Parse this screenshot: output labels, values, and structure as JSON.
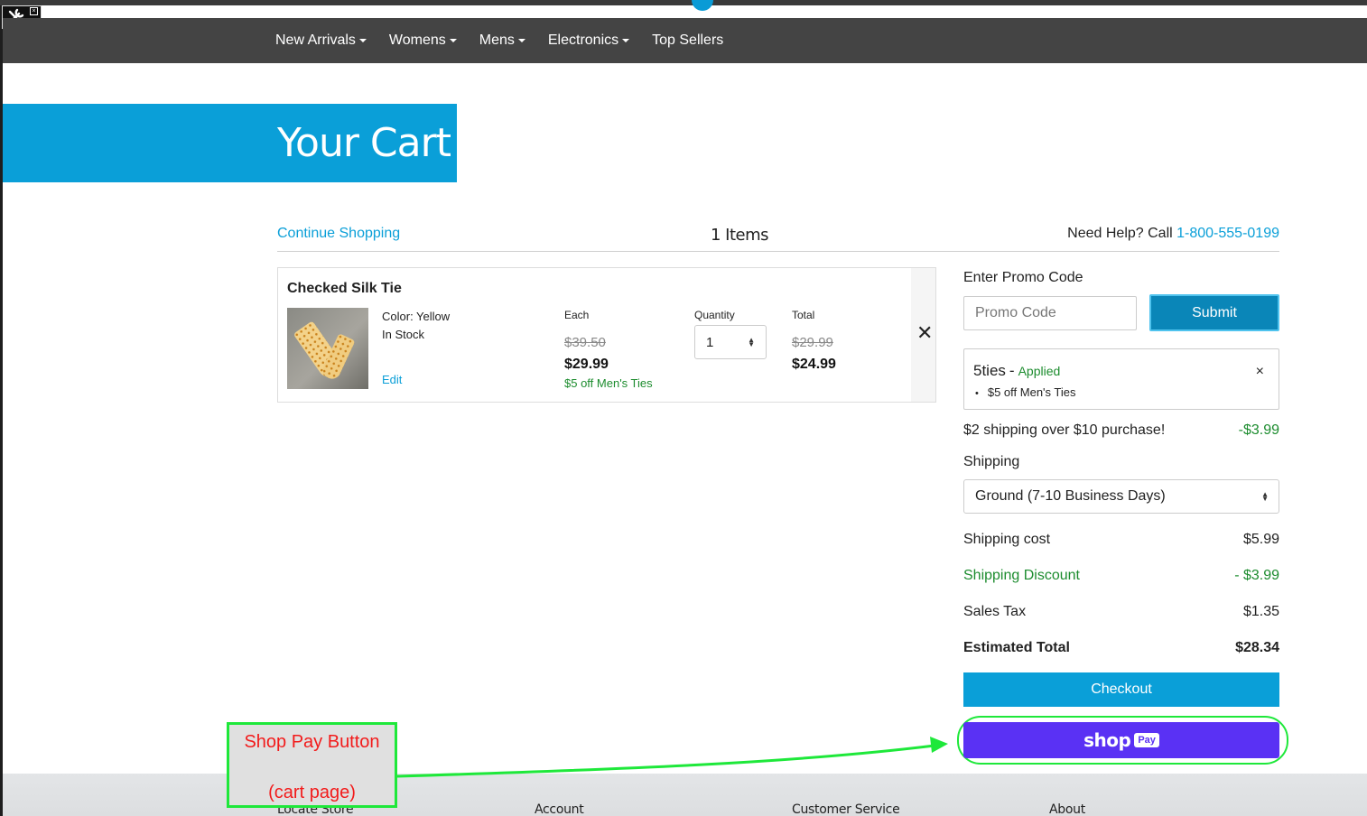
{
  "nav": {
    "items": [
      {
        "label": "New Arrivals",
        "dropdown": true
      },
      {
        "label": "Womens",
        "dropdown": true
      },
      {
        "label": "Mens",
        "dropdown": true
      },
      {
        "label": "Electronics",
        "dropdown": true
      },
      {
        "label": "Top Sellers",
        "dropdown": false
      }
    ]
  },
  "hero": {
    "title": "Your Cart"
  },
  "cart_header": {
    "continue": "Continue Shopping",
    "items_count": "1 Items",
    "help_text": "Need Help? Call ",
    "help_phone": "1-800-555-0199"
  },
  "item": {
    "title": "Checked Silk Tie",
    "color": "Color: Yellow",
    "stock": "In Stock",
    "edit": "Edit",
    "each_label": "Each",
    "each_old": "$39.50",
    "each_new": "$29.99",
    "promo_note": "$5 off Men's Ties",
    "quantity_label": "Quantity",
    "quantity": "1",
    "total_label": "Total",
    "total_old": "$29.99",
    "total_new": "$24.99",
    "remove": "✕"
  },
  "summary": {
    "promo_label": "Enter Promo Code",
    "promo_placeholder": "Promo Code",
    "submit": "Submit",
    "applied_code": "5ties",
    "applied_dash": "-",
    "applied_status": "Applied",
    "applied_detail": "$5 off Men's Ties",
    "applied_remove": "×",
    "shipping_promo": "$2 shipping over $10 purchase!",
    "shipping_promo_value": "-$3.99",
    "shipping_label": "Shipping",
    "shipping_method": "Ground (7-10 Business Days)",
    "shipping_cost_label": "Shipping cost",
    "shipping_cost": "$5.99",
    "shipping_discount_label": "Shipping Discount",
    "shipping_discount": "- $3.99",
    "sales_tax_label": "Sales Tax",
    "sales_tax": "$1.35",
    "estimated_total_label": "Estimated Total",
    "estimated_total": "$28.34",
    "checkout": "Checkout",
    "shoppay_word": "shop",
    "shoppay_chip": "Pay"
  },
  "footer": {
    "links": [
      "Locate Store",
      "Account",
      "Customer Service",
      "About"
    ]
  },
  "annotation": {
    "line1": "Shop Pay Button",
    "line2": "(cart page)"
  },
  "colors": {
    "accent": "#0a9fd8",
    "navbar": "#444444",
    "promo_green": "#1c8c2e",
    "shoppay": "#5a31f4",
    "annotation_green": "#1ee83a",
    "annotation_red": "#f21b1b"
  }
}
